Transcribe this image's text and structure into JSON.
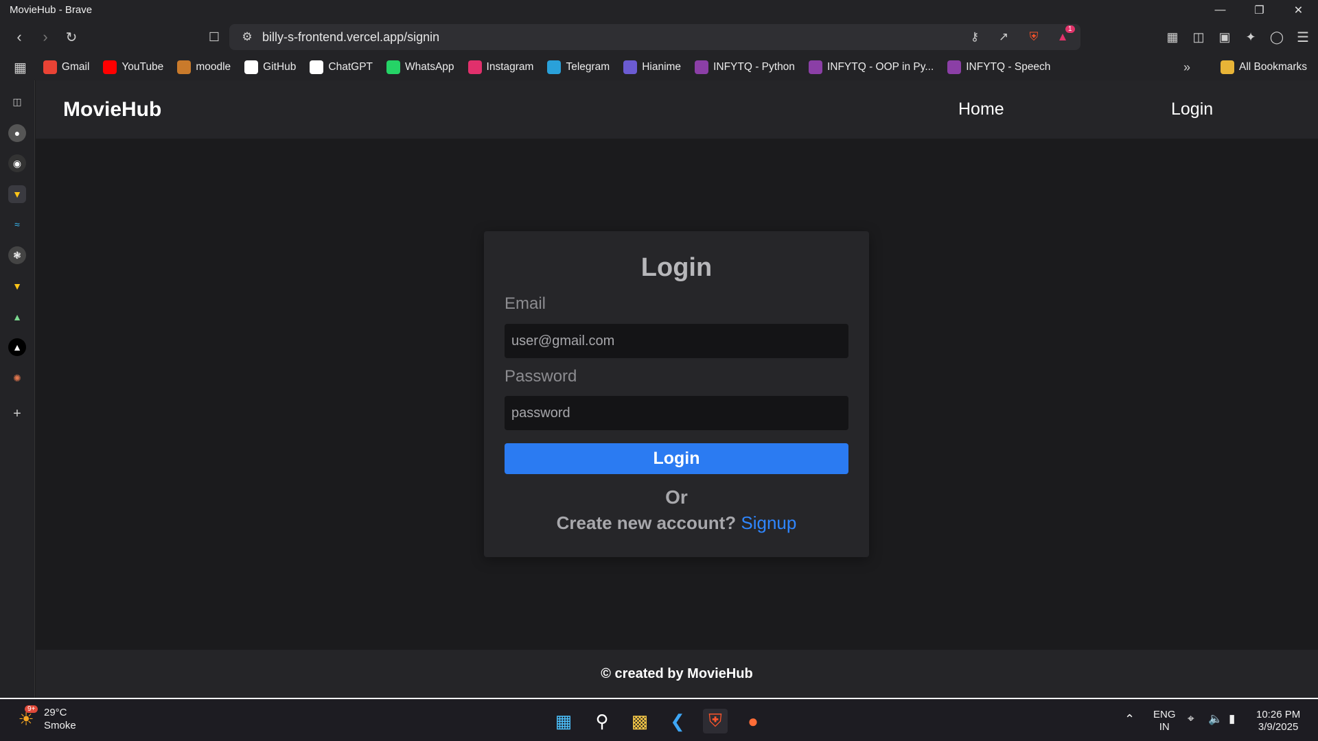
{
  "window": {
    "title": "MovieHub - Brave",
    "controls": [
      "minimize",
      "restore",
      "close"
    ]
  },
  "toolbar": {
    "url": "billy-s-frontend.vercel.app/signin",
    "notification_count": "1"
  },
  "bookmarks": [
    {
      "label": "Gmail",
      "icon": "gmail-icon",
      "color": "#ea4335"
    },
    {
      "label": "YouTube",
      "icon": "youtube-icon",
      "color": "#ff0000"
    },
    {
      "label": "moodle",
      "icon": "moodle-icon",
      "color": "#c97a2b"
    },
    {
      "label": "GitHub",
      "icon": "github-icon",
      "color": "#ffffff"
    },
    {
      "label": "ChatGPT",
      "icon": "chatgpt-icon",
      "color": "#ffffff"
    },
    {
      "label": "WhatsApp",
      "icon": "whatsapp-icon",
      "color": "#25d366"
    },
    {
      "label": "Instagram",
      "icon": "instagram-icon",
      "color": "#e1306c"
    },
    {
      "label": "Telegram",
      "icon": "telegram-icon",
      "color": "#2aa1da"
    },
    {
      "label": "Hianime",
      "icon": "hianime-icon",
      "color": "#6b5bd2"
    },
    {
      "label": "INFYTQ - Python",
      "icon": "infytq-icon",
      "color": "#8b3fa6"
    },
    {
      "label": "INFYTQ - OOP in Py...",
      "icon": "infytq-icon",
      "color": "#8b3fa6"
    },
    {
      "label": "INFYTQ - Speech",
      "icon": "infytq-icon",
      "color": "#8b3fa6"
    }
  ],
  "all_bookmarks_label": "All Bookmarks",
  "site": {
    "brand": "MovieHub",
    "nav_home": "Home",
    "nav_login": "Login",
    "footer": "© created by MovieHub"
  },
  "login_form": {
    "heading": "Login",
    "email_label": "Email",
    "email_placeholder": "user@gmail.com",
    "password_label": "Password",
    "password_placeholder": "password",
    "submit_label": "Login",
    "or_text": "Or",
    "create_prompt": "Create new account?",
    "signup_link": "Signup"
  },
  "taskbar": {
    "weather_temp": "29°C",
    "weather_desc": "Smoke",
    "weather_badge": "9+",
    "lang_line1": "ENG",
    "lang_line2": "IN",
    "time": "10:26 PM",
    "date": "3/9/2025"
  },
  "colors": {
    "accent": "#2b7bf2",
    "link": "#2f86ff",
    "page_bg": "#1b1b1d",
    "card_bg": "#262629"
  }
}
